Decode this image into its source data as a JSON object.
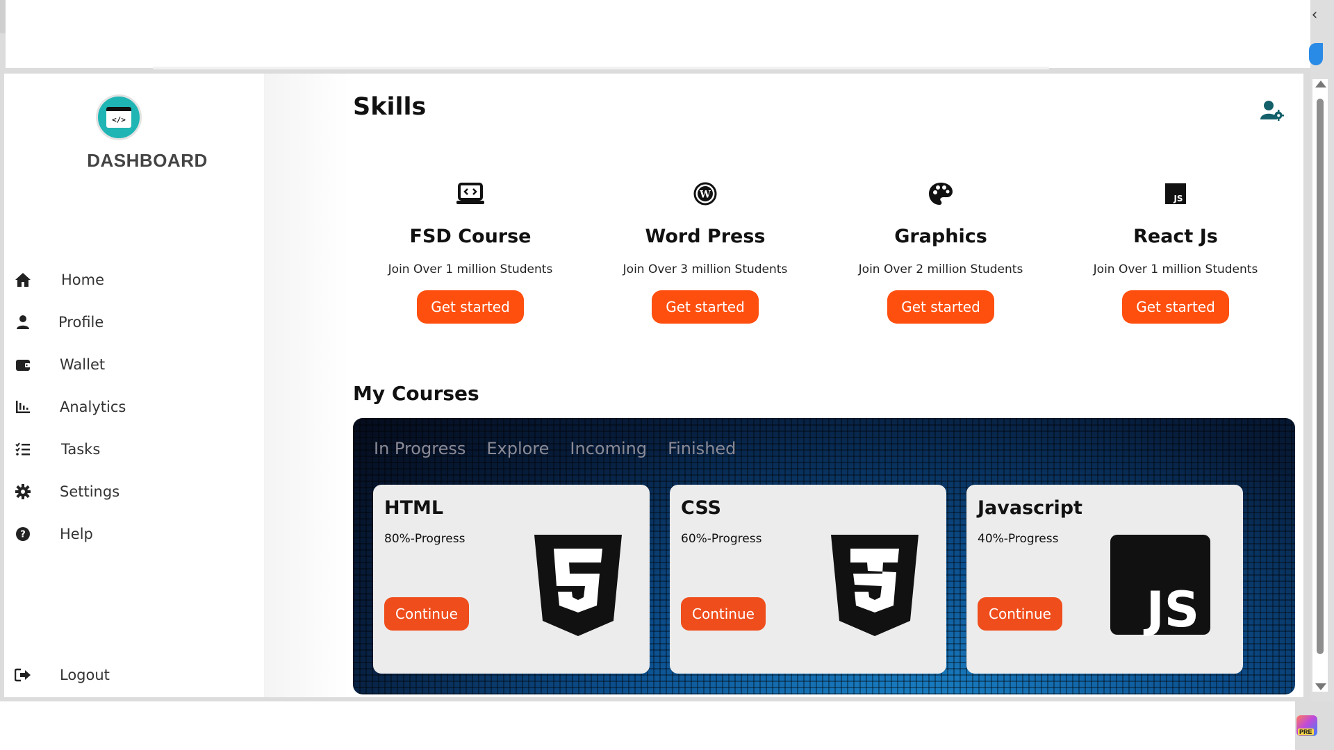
{
  "sidebar": {
    "brand": "DASHBOARD",
    "logo_text": "</>",
    "items": [
      {
        "label": "Home",
        "icon": "home-icon"
      },
      {
        "label": "Profile",
        "icon": "user-icon"
      },
      {
        "label": "Wallet",
        "icon": "wallet-icon"
      },
      {
        "label": "Analytics",
        "icon": "chart-icon"
      },
      {
        "label": "Tasks",
        "icon": "tasks-icon"
      },
      {
        "label": "Settings",
        "icon": "gear-icon"
      },
      {
        "label": "Help",
        "icon": "help-icon"
      }
    ],
    "logout": {
      "label": "Logout",
      "icon": "logout-icon"
    }
  },
  "header": {
    "title": "Skills",
    "user_settings_icon": "user-gear-icon"
  },
  "skills": [
    {
      "title": "FSD Course",
      "subtitle": "Join Over 1 million Students",
      "button": "Get started",
      "icon": "code-laptop-icon"
    },
    {
      "title": "Word Press",
      "subtitle": "Join Over 3 million Students",
      "button": "Get started",
      "icon": "wordpress-icon"
    },
    {
      "title": "Graphics",
      "subtitle": "Join Over 2 million Students",
      "button": "Get started",
      "icon": "palette-icon"
    },
    {
      "title": "React Js",
      "subtitle": "Join Over 1 million Students",
      "button": "Get started",
      "icon": "js-icon"
    }
  ],
  "my_courses": {
    "title": "My Courses",
    "tabs": [
      "In Progress",
      "Explore",
      "Incoming",
      "Finished"
    ],
    "courses": [
      {
        "title": "HTML",
        "progress_text": "80%-Progress",
        "progress": 0.8,
        "button": "Continue",
        "icon": "html5-icon"
      },
      {
        "title": "CSS",
        "progress_text": "60%-Progress",
        "progress": 0.6,
        "button": "Continue",
        "icon": "css3-icon"
      },
      {
        "title": "Javascript",
        "progress_text": "40%-Progress",
        "progress": 0.4,
        "button": "Continue",
        "icon": "javascript-icon",
        "icon_text": "JS"
      }
    ]
  },
  "colors": {
    "accent": "#ff4f0f",
    "course_button": "#ef4d1c",
    "logo_bg": "#1fb5b4",
    "header_icon": "#14606a"
  }
}
